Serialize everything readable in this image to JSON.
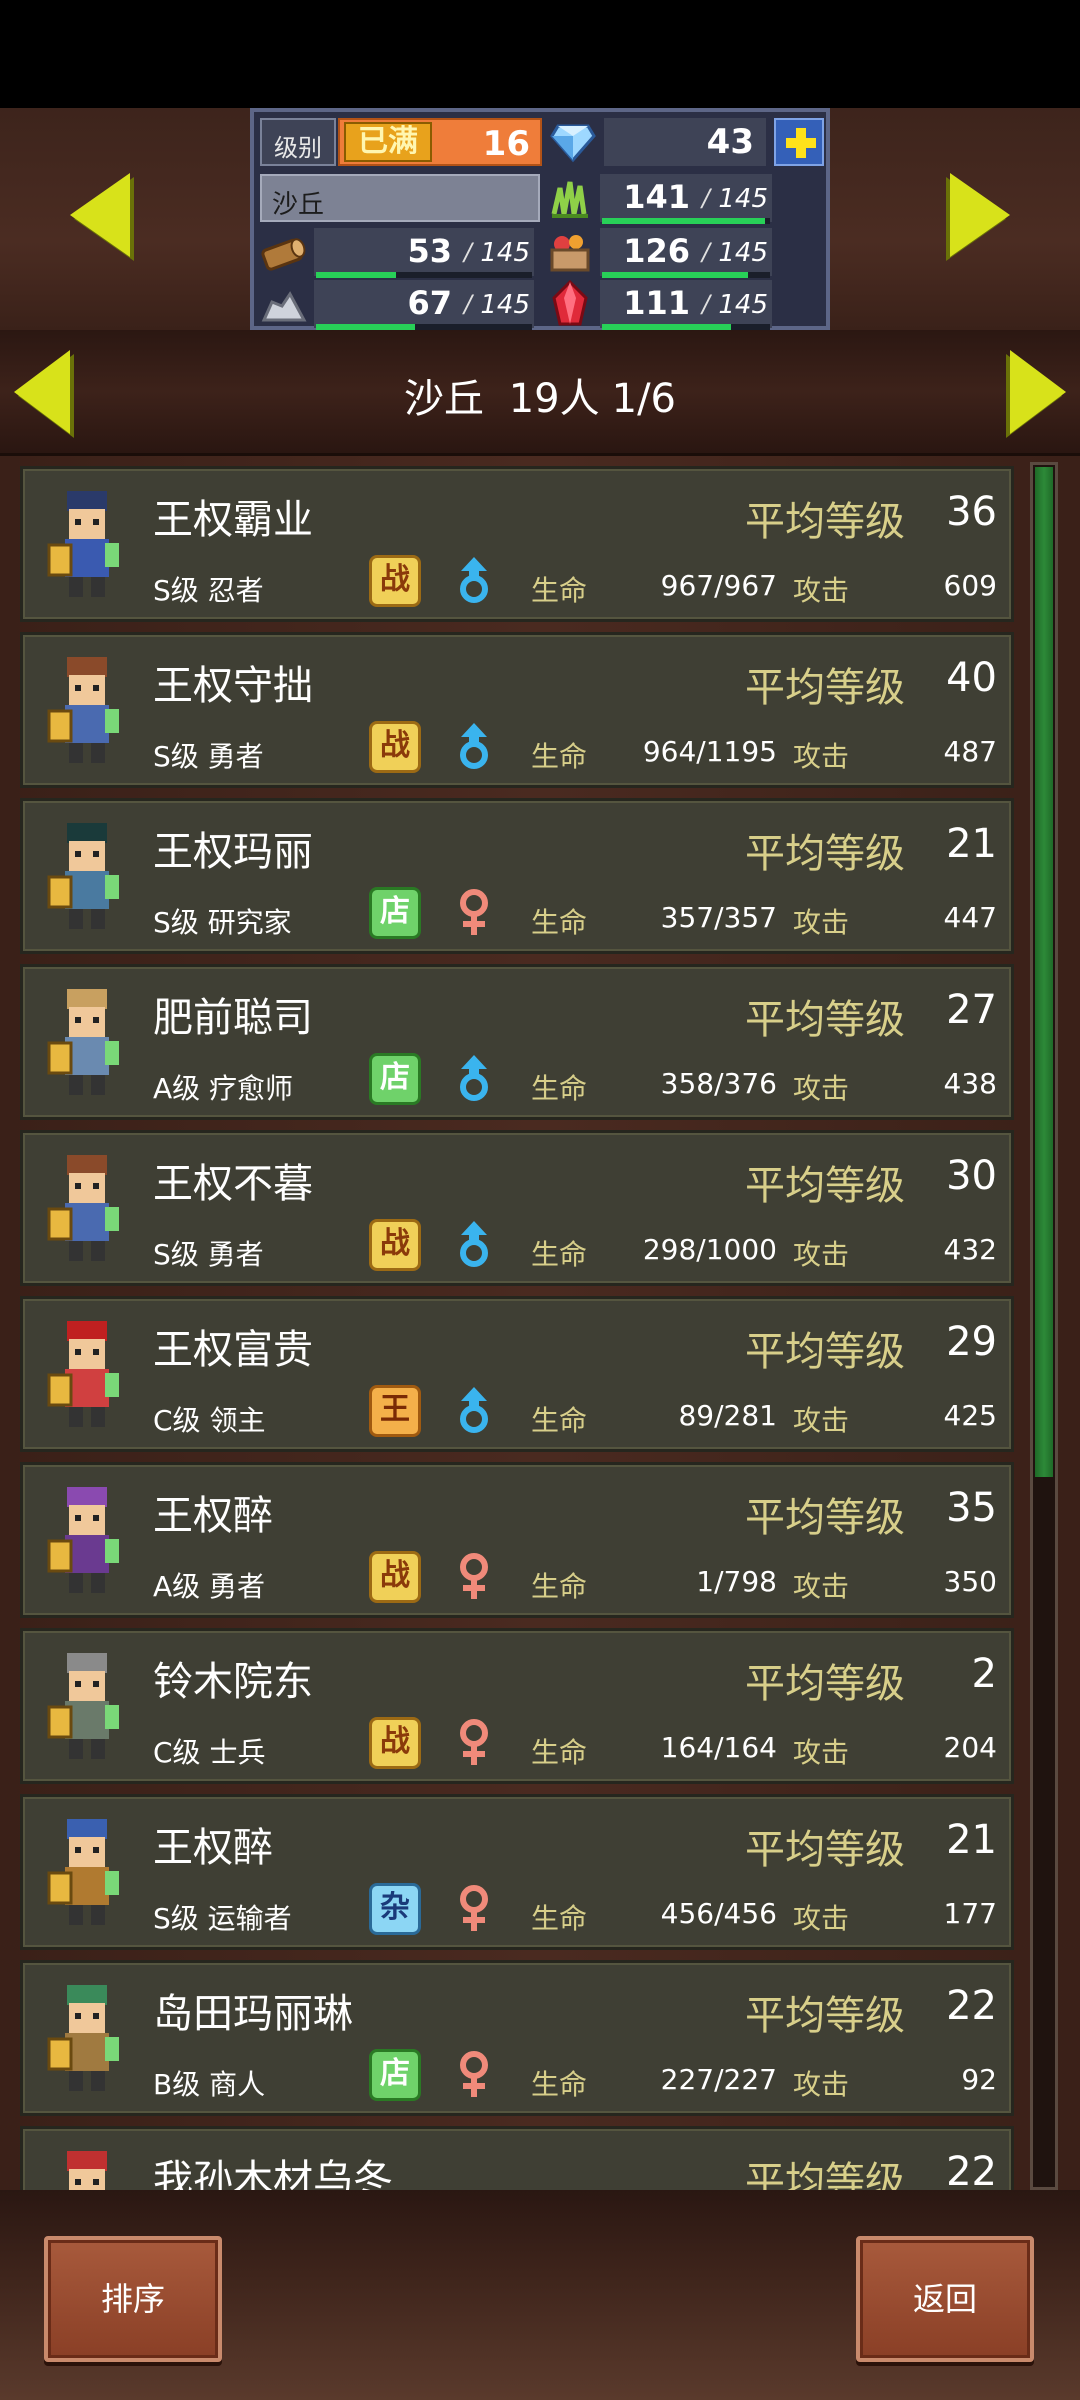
{
  "resources": {
    "level_label": "级别",
    "level_max_badge": "已满",
    "level_value": "16",
    "gems": "43",
    "area_name": "沙丘",
    "grass": {
      "current": "141",
      "sep": "/",
      "max": "145",
      "fill": 0.97
    },
    "wood": {
      "current": "53",
      "sep": "/",
      "max": "145",
      "fill": 0.37
    },
    "food": {
      "current": "126",
      "sep": "/",
      "max": "145",
      "fill": 0.87
    },
    "ore": {
      "current": "67",
      "sep": "/",
      "max": "145",
      "fill": 0.46
    },
    "crystal": {
      "current": "111",
      "sep": "/",
      "max": "145",
      "fill": 0.77
    }
  },
  "header": {
    "area": "沙丘",
    "count": "19人",
    "page": "1/6"
  },
  "labels": {
    "avg_level": "平均等级",
    "hp": "生命",
    "atk": "攻击"
  },
  "heroes": [
    {
      "name": "王权霸业",
      "rank_job": "S级 忍者",
      "job_badge": "战",
      "badge_style": "yellow",
      "gender": "male",
      "avg": "36",
      "hp": "967/967",
      "atk": "609"
    },
    {
      "name": "王权守拙",
      "rank_job": "S级 勇者",
      "job_badge": "战",
      "badge_style": "yellow",
      "gender": "male",
      "avg": "40",
      "hp": "964/1195",
      "atk": "487"
    },
    {
      "name": "王权玛丽",
      "rank_job": "S级 研究家",
      "job_badge": "店",
      "badge_style": "green",
      "gender": "female",
      "avg": "21",
      "hp": "357/357",
      "atk": "447"
    },
    {
      "name": "肥前聪司",
      "rank_job": "A级 疗愈师",
      "job_badge": "店",
      "badge_style": "green",
      "gender": "male",
      "avg": "27",
      "hp": "358/376",
      "atk": "438"
    },
    {
      "name": "王权不暮",
      "rank_job": "S级 勇者",
      "job_badge": "战",
      "badge_style": "yellow",
      "gender": "male",
      "avg": "30",
      "hp": "298/1000",
      "atk": "432"
    },
    {
      "name": "王权富贵",
      "rank_job": "C级 领主",
      "job_badge": "王",
      "badge_style": "orange",
      "gender": "male",
      "avg": "29",
      "hp": "89/281",
      "atk": "425"
    },
    {
      "name": "王权醉",
      "rank_job": "A级 勇者",
      "job_badge": "战",
      "badge_style": "yellow",
      "gender": "female",
      "avg": "35",
      "hp": "1/798",
      "atk": "350"
    },
    {
      "name": "铃木院东",
      "rank_job": "C级 士兵",
      "job_badge": "战",
      "badge_style": "yellow",
      "gender": "female",
      "avg": "2",
      "hp": "164/164",
      "atk": "204"
    },
    {
      "name": "王权醉",
      "rank_job": "S级 运输者",
      "job_badge": "杂",
      "badge_style": "blue",
      "gender": "female",
      "avg": "21",
      "hp": "456/456",
      "atk": "177"
    },
    {
      "name": "岛田玛丽琳",
      "rank_job": "B级 商人",
      "job_badge": "店",
      "badge_style": "green",
      "gender": "female",
      "avg": "22",
      "hp": "227/227",
      "atk": "92"
    },
    {
      "name": "我孙木材乌冬",
      "rank_job": "",
      "job_badge": "",
      "badge_style": "yellow",
      "gender": "",
      "avg": "22",
      "hp": "",
      "atk": ""
    }
  ],
  "buttons": {
    "sort": "排序",
    "back": "返回"
  },
  "colors": {
    "panel_bg": "#3f3f34",
    "label_gold": "#d8cf8a",
    "arrow_yellow": "#d8e21a",
    "male_blue": "#3ab4ee",
    "female_pink": "#f08a7a",
    "hp_bar_green": "#28d058"
  },
  "scroll": {
    "position": 0.0,
    "visible_fraction": 0.58
  }
}
